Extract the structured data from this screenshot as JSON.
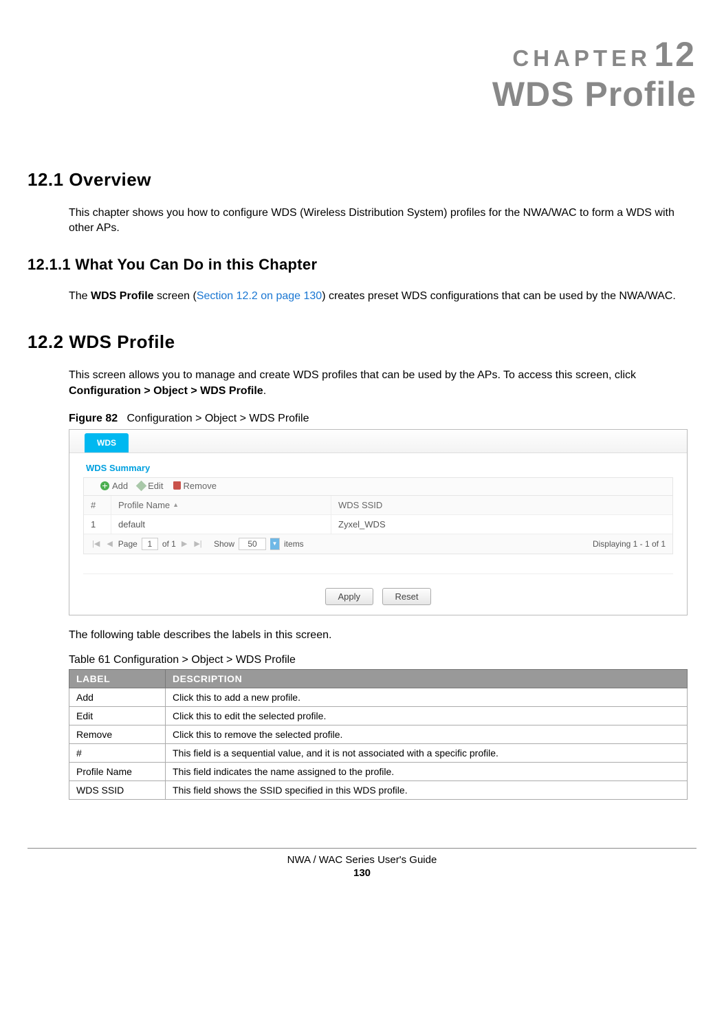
{
  "chapter": {
    "label": "CHAPTER",
    "number": "12",
    "title": "WDS Profile"
  },
  "section_12_1": {
    "heading": "12.1  Overview",
    "body": "This chapter shows you how to configure WDS (Wireless Distribution System) profiles for the NWA/WAC to form a WDS with other APs."
  },
  "section_12_1_1": {
    "heading": "12.1.1  What You Can Do in this Chapter",
    "body_pre": "The ",
    "bold1": "WDS Profile",
    "body_mid1": " screen (",
    "link": "Section 12.2 on page 130",
    "body_post": ") creates preset WDS configurations that can be used by the NWA/WAC."
  },
  "section_12_2": {
    "heading": "12.2  WDS Profile",
    "body_pre": "This screen allows you to manage and create WDS profiles that can be used by the APs. To access this screen, click ",
    "bold_path": "Configuration > Object > WDS Profile",
    "body_post": "."
  },
  "figure": {
    "label": "Figure 82",
    "caption": "Configuration > Object > WDS Profile"
  },
  "screenshot": {
    "tab": "WDS",
    "panel_title": "WDS Summary",
    "toolbar": {
      "add": "Add",
      "edit": "Edit",
      "remove": "Remove"
    },
    "grid": {
      "head_num": "#",
      "head_name": "Profile Name",
      "head_ssid": "WDS SSID",
      "row": {
        "num": "1",
        "name": "default",
        "ssid": "Zyxel_WDS"
      }
    },
    "pager": {
      "page_label": "Page",
      "page_val": "1",
      "of": "of 1",
      "show_label": "Show",
      "show_val": "50",
      "items": "items",
      "displaying": "Displaying 1 - 1 of 1"
    },
    "buttons": {
      "apply": "Apply",
      "reset": "Reset"
    }
  },
  "desc_intro": "The following table describes the labels in this screen.",
  "table": {
    "caption": "Table 61   Configuration > Object > WDS Profile",
    "head_label": "LABEL",
    "head_desc": "DESCRIPTION",
    "rows": [
      {
        "label": "Add",
        "desc": "Click this to add a new profile."
      },
      {
        "label": "Edit",
        "desc": "Click this to edit the selected profile."
      },
      {
        "label": "Remove",
        "desc": "Click this to remove the selected profile."
      },
      {
        "label": "#",
        "desc": "This field is a sequential value, and it is not associated with a specific profile."
      },
      {
        "label": "Profile Name",
        "desc": "This field indicates the name assigned to the profile."
      },
      {
        "label": "WDS SSID",
        "desc": "This field shows the SSID specified in this WDS profile."
      }
    ]
  },
  "footer": {
    "guide": "NWA / WAC Series User's Guide",
    "page": "130"
  }
}
